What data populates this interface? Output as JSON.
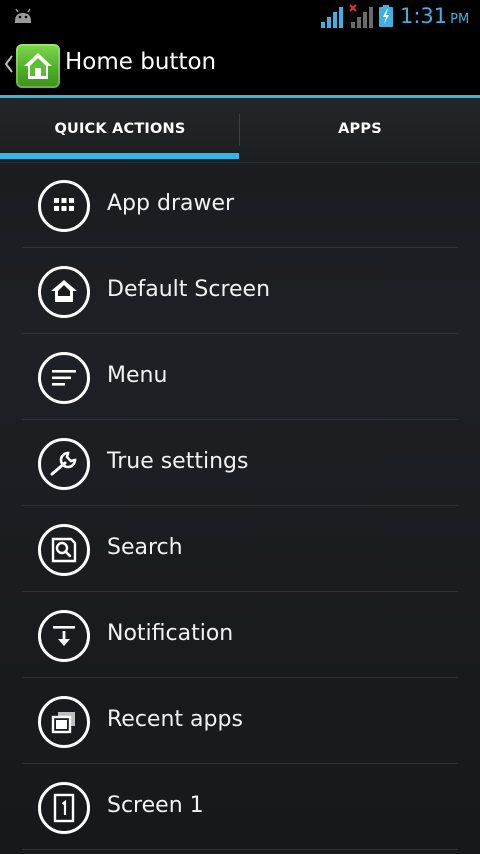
{
  "status_bar": {
    "time": "1:31",
    "ampm": "PM",
    "icons": [
      "android-icon",
      "signal-icon",
      "signal-no-data-icon",
      "battery-charging-icon"
    ],
    "accent_color": "#3fb0e1"
  },
  "action_bar": {
    "title": "Home button",
    "icons": [
      "up-chevron-icon",
      "home-app-icon"
    ]
  },
  "tabs": [
    {
      "label": "QUICK ACTIONS",
      "selected": true
    },
    {
      "label": "APPS",
      "selected": false
    }
  ],
  "accent_color": "#33b5e5",
  "list": {
    "items": [
      {
        "label": "App drawer",
        "icon": "app-drawer-icon"
      },
      {
        "label": "Default Screen",
        "icon": "home-icon"
      },
      {
        "label": "Menu",
        "icon": "menu-icon"
      },
      {
        "label": "True settings",
        "icon": "wrench-icon"
      },
      {
        "label": "Search",
        "icon": "search-icon"
      },
      {
        "label": "Notification",
        "icon": "notification-icon"
      },
      {
        "label": "Recent apps",
        "icon": "recent-apps-icon"
      },
      {
        "label": "Screen 1",
        "icon": "screen-icon"
      }
    ]
  }
}
